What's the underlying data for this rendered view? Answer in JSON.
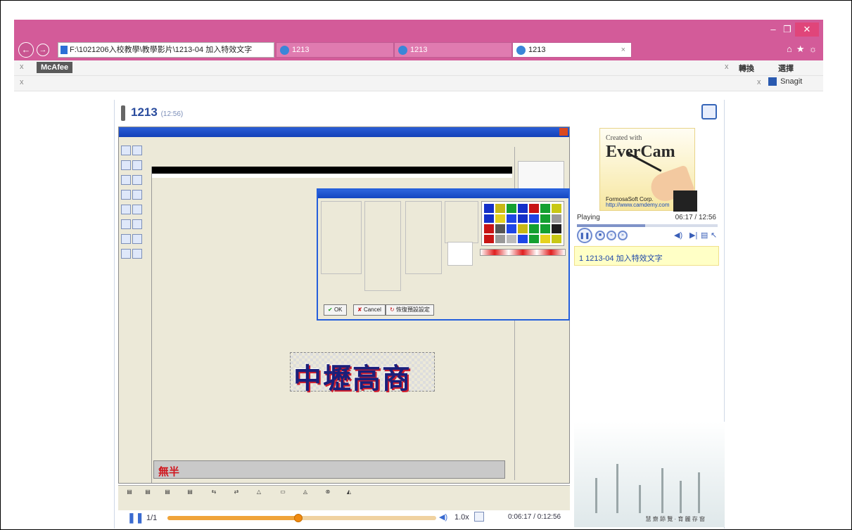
{
  "browser": {
    "address": "F:\\1021206入校教學\\教學影片\\1213-04 加入特效文字",
    "tabs": [
      {
        "label": "1213",
        "active": false
      },
      {
        "label": "1213",
        "active": false
      },
      {
        "label": "1213",
        "active": true
      }
    ],
    "window_controls": {
      "min": "–",
      "max": "❐",
      "close": "✕"
    },
    "right_icons": "⌂★☼",
    "toolbar1": {
      "close": "x",
      "mcafee": "McAfee",
      "right_close": "x",
      "convert": "轉換",
      "select": "選擇"
    },
    "toolbar2": {
      "close": "x",
      "right_close": "x",
      "snagit": "Snagit"
    }
  },
  "player": {
    "title": "1213",
    "duration": "(12:56)",
    "page": "1/1",
    "speed": "1.0x",
    "time": "0:06:17 / 0:12:56",
    "progress_fraction": 0.486
  },
  "recorded": {
    "big_text": "中壢高商",
    "strip_text": "無半",
    "dialog_buttons": {
      "ok": "OK",
      "cancel": "Cancel",
      "reset": "恢復預設設定"
    }
  },
  "side": {
    "created": "Created with",
    "brand": "EverCam",
    "corp": "FormosaSoft Corp.",
    "url": "http://www.camdemy.com",
    "status": "Playing",
    "time": "06:17 / 12:56",
    "chapter": "1  1213-04 加入特效文字",
    "landscape_caption": "慧 齋 舔 覽 · 育 麗 存 窗"
  },
  "colors": {
    "chrome": "#d35b99",
    "accent": "#3a6bd0",
    "progress": "#f0a43a"
  }
}
